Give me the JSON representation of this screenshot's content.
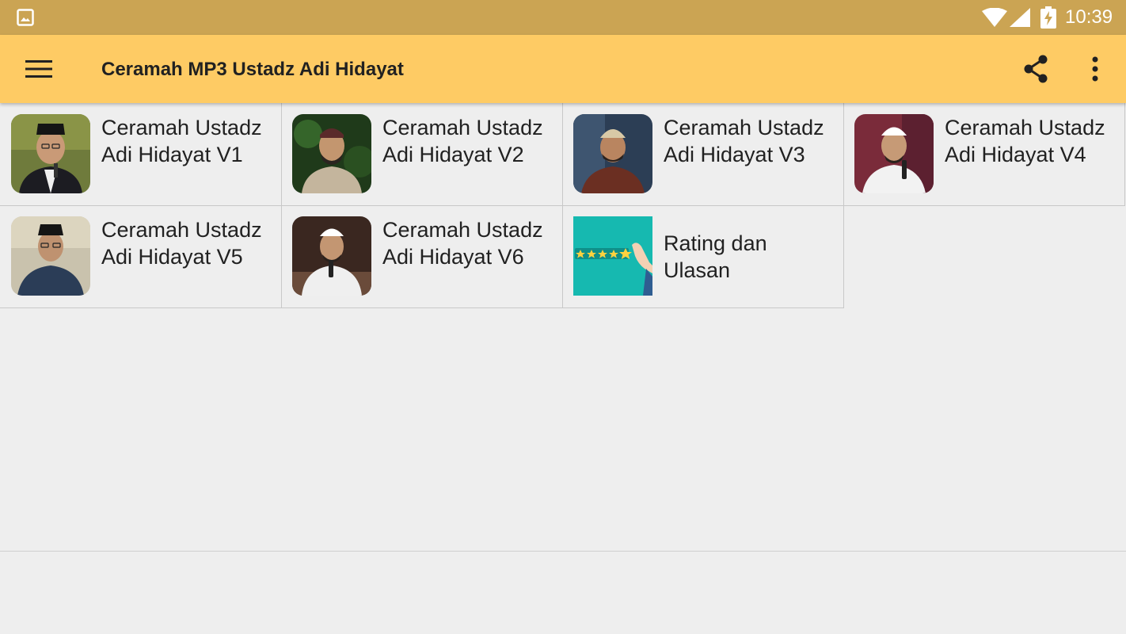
{
  "status_bar": {
    "time": "10:39",
    "icons": [
      "gallery-icon",
      "wifi-icon",
      "signal-icon",
      "battery-charging-icon"
    ]
  },
  "app_bar": {
    "title": "Ceramah MP3 Ustadz Adi Hidayat",
    "icons": [
      "menu-icon",
      "share-icon",
      "more-vert-icon"
    ]
  },
  "grid": {
    "items": [
      {
        "label": "Ceramah Ustadz Adi Hidayat V1"
      },
      {
        "label": "Ceramah Ustadz Adi Hidayat V2"
      },
      {
        "label": "Ceramah Ustadz Adi Hidayat V3"
      },
      {
        "label": "Ceramah Ustadz Adi Hidayat V4"
      },
      {
        "label": "Ceramah Ustadz Adi Hidayat V5"
      },
      {
        "label": "Ceramah Ustadz Adi Hidayat V6"
      },
      {
        "label": "Rating dan Ulasan"
      }
    ]
  },
  "colors": {
    "status_bar": "#cba453",
    "app_bar": "#fecb64",
    "background": "#eeeeee",
    "rating_tile": "#16b9b0"
  }
}
